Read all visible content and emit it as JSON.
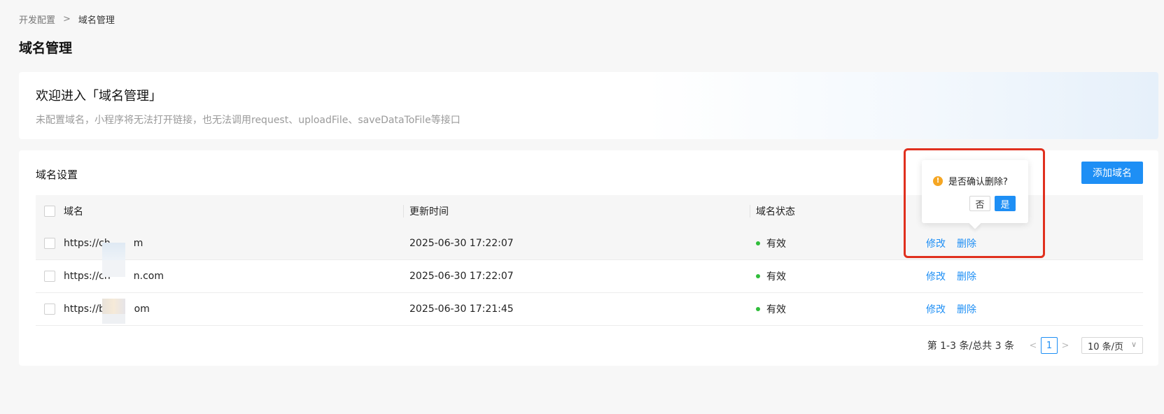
{
  "breadcrumb": {
    "parent": "开发配置",
    "separator": ">",
    "current": "域名管理"
  },
  "page_title": "域名管理",
  "welcome": {
    "title": "欢迎进入「域名管理」",
    "description": "未配置域名，小程序将无法打开链接，也无法调用request、uploadFile、saveDataToFile等接口"
  },
  "settings": {
    "title": "域名设置",
    "add_button": "添加域名",
    "columns": {
      "domain": "域名",
      "time": "更新时间",
      "status": "域名状态"
    },
    "rows": [
      {
        "domain": "https://ch",
        "domain_tail": "m",
        "time": "2025-06-30 17:22:07",
        "status": "有效",
        "edit": "修改",
        "delete": "删除"
      },
      {
        "domain": "https://ch",
        "domain_tail": "n.com",
        "time": "2025-06-30 17:22:07",
        "status": "有效",
        "edit": "修改",
        "delete": "删除"
      },
      {
        "domain": "https://ba",
        "domain_tail": "om",
        "time": "2025-06-30 17:21:45",
        "status": "有效",
        "edit": "修改",
        "delete": "删除"
      }
    ]
  },
  "pagination": {
    "total_text": "第 1-3 条/总共 3 条",
    "current_page": "1",
    "prev": "<",
    "next": ">",
    "page_size": "10 条/页",
    "chevron": "∨"
  },
  "popconfirm": {
    "icon": "!",
    "message": "是否确认删除?",
    "no": "否",
    "yes": "是"
  },
  "colors": {
    "primary": "#1e8ff5",
    "valid_dot": "#2fbd3a",
    "warning": "#f5a623",
    "highlight": "#e0301e"
  }
}
